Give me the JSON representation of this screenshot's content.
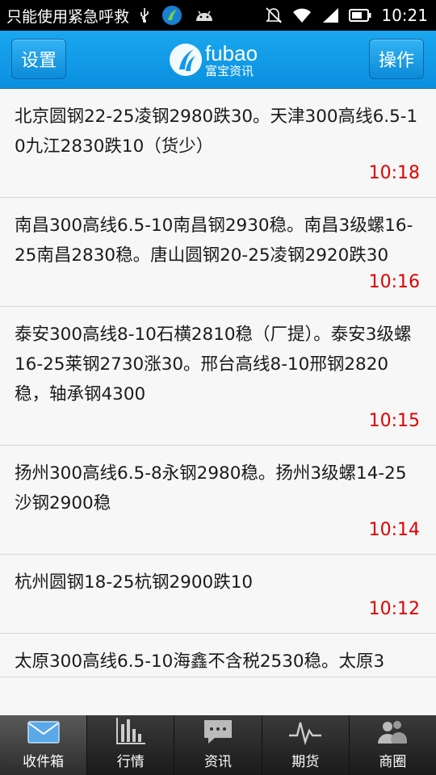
{
  "status_bar": {
    "carrier": "只能使用紧急呼救",
    "time": "10:21"
  },
  "header": {
    "left_button": "设置",
    "right_button": "操作",
    "logo_en": "fubao",
    "logo_cn": "富宝资讯"
  },
  "messages": [
    {
      "text": "北京圆钢22-25凌钢2980跌30。天津300高线6.5-10九江2830跌10（货少）",
      "time": "10:18"
    },
    {
      "text": "南昌300高线6.5-10南昌钢2930稳。南昌3级螺16-25南昌2830稳。唐山圆钢20-25凌钢2920跌30",
      "time": "10:16"
    },
    {
      "text": "泰安300高线8-10石横2810稳（厂提）。泰安3级螺16-25莱钢2730涨30。邢台高线8-10邢钢2820稳，轴承钢4300",
      "time": "10:15"
    },
    {
      "text": "扬州300高线6.5-8永钢2980稳。扬州3级螺14-25沙钢2900稳",
      "time": "10:14"
    },
    {
      "text": "杭州圆钢18-25杭钢2900跌10",
      "time": "10:12"
    },
    {
      "text": "太原300高线6.5-10海鑫不含税2530稳。太原3",
      "time": ""
    }
  ],
  "tabs": [
    {
      "label": "收件箱",
      "icon": "envelope-icon",
      "active": true
    },
    {
      "label": "行情",
      "icon": "bar-chart-icon",
      "active": false
    },
    {
      "label": "资讯",
      "icon": "chat-bubble-icon",
      "active": false
    },
    {
      "label": "期货",
      "icon": "pulse-icon",
      "active": false
    },
    {
      "label": "商圈",
      "icon": "people-icon",
      "active": false
    }
  ],
  "colors": {
    "header_blue": "#0a8fe0",
    "time_red": "#e00000"
  }
}
